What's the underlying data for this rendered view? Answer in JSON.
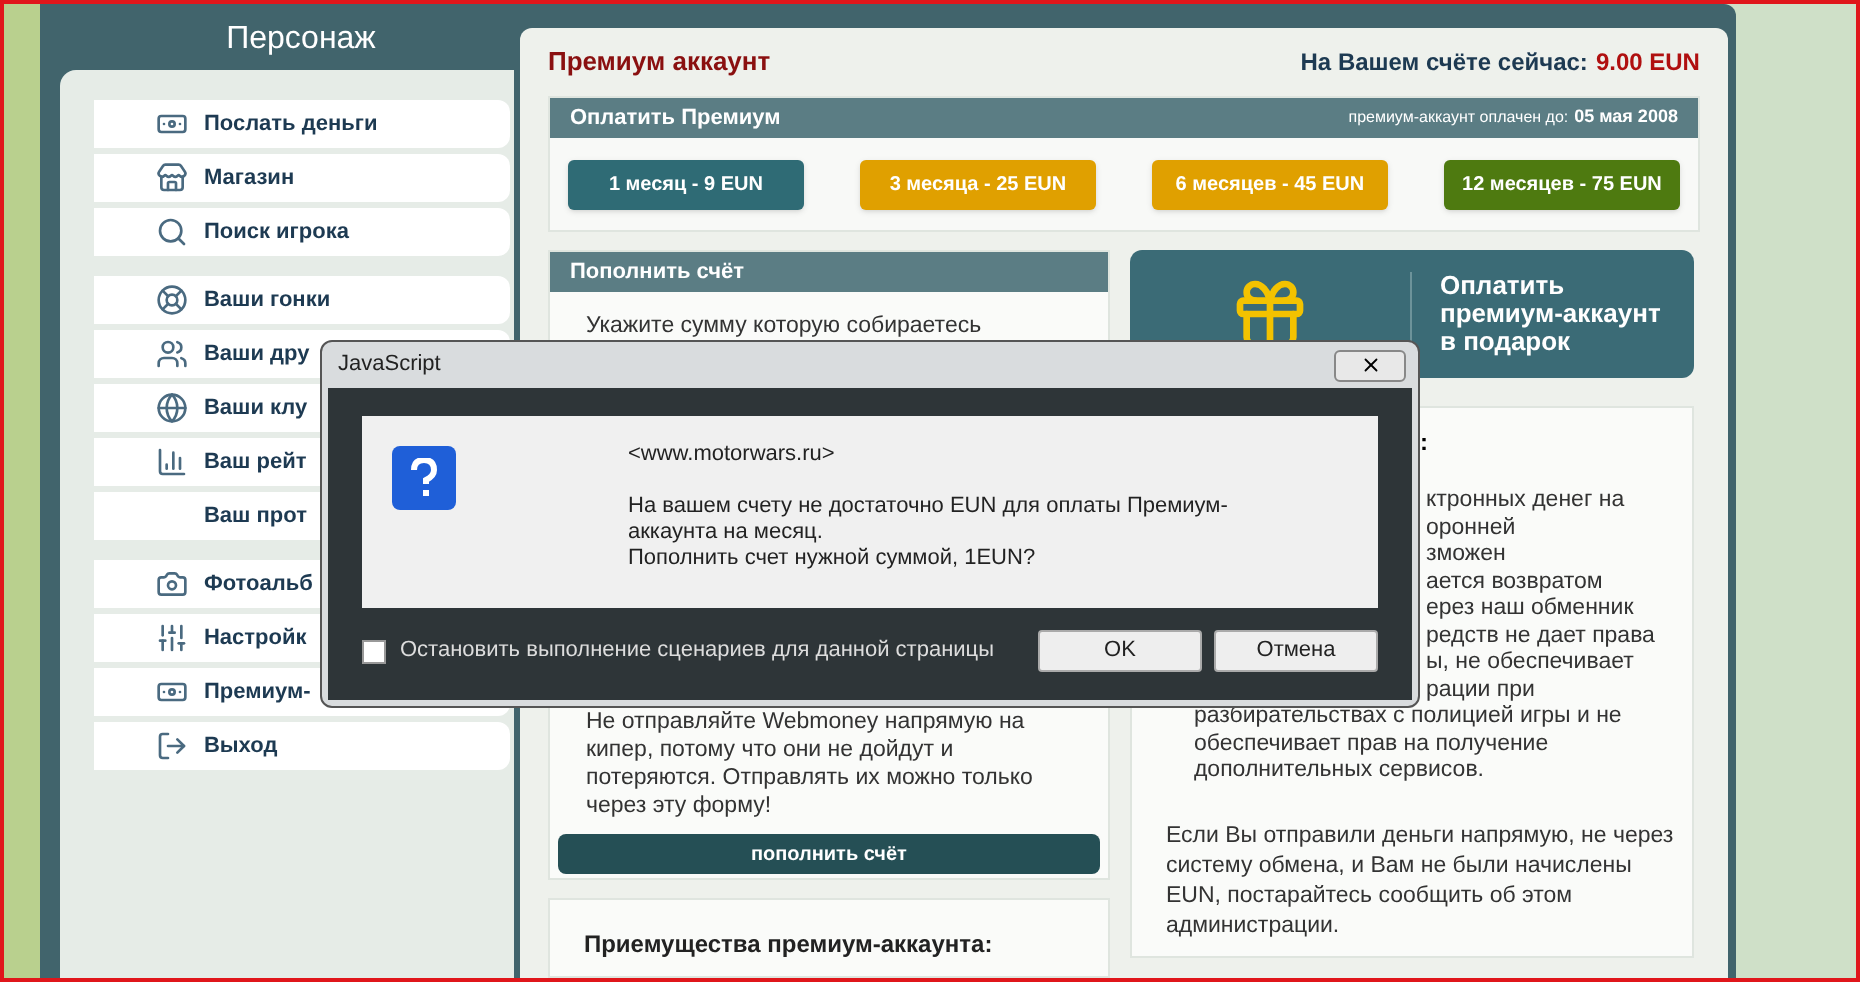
{
  "sidebar": {
    "title": "Персонаж",
    "groups": [
      [
        {
          "label": "Послать деньги"
        },
        {
          "label": "Магазин"
        },
        {
          "label": "Поиск игрока"
        }
      ],
      [
        {
          "label": "Ваши гонки"
        },
        {
          "label": "Ваши дру"
        },
        {
          "label": "Ваши клу"
        },
        {
          "label": "Ваш рейт"
        },
        {
          "label": "Ваш прот"
        }
      ],
      [
        {
          "label": "Фотоальб"
        },
        {
          "label": "Настройк"
        },
        {
          "label": "Премиум-"
        },
        {
          "label": "Выход"
        }
      ]
    ]
  },
  "page": {
    "title": "Премиум аккаунт",
    "balance_label": "На Вашем счёте сейчас:",
    "balance_value": "9.00 EUN"
  },
  "premium": {
    "title": "Оплатить Премиум",
    "paid_until_label": "премиум-аккаунт оплачен до:",
    "paid_until_date": "05 мая 2008",
    "options": [
      {
        "label": "1 месяц - 9 EUN",
        "color": "#2f6b75"
      },
      {
        "label": "3 месяца - 25 EUN",
        "color": "#e0a000"
      },
      {
        "label": "6 месяцев - 45 EUN",
        "color": "#e0a000"
      },
      {
        "label": "12 месяцев - 75 EUN",
        "color": "#4e7a10"
      }
    ]
  },
  "top_up": {
    "title": "Пополнить счёт",
    "intro": "Укажите сумму которую собираетесь",
    "warning_lines": [
      "Не отправляйте Webmoney напрямую на",
      "кипер, потому что они не дойдут и",
      "потеряются. Отправлять их можно только",
      "через эту форму!"
    ],
    "button": "пополнить счёт"
  },
  "advantages": {
    "title": "Приемущества премиум-аккаунта:"
  },
  "gift_banner": {
    "lines": [
      "Оплатить",
      "премиум-аккаунт",
      "в подарок"
    ]
  },
  "info": {
    "heading": ":",
    "lines": [
      {
        "kind": "cut",
        "text": "ктронных денег на"
      },
      {
        "kind": "cut",
        "text": "оронней"
      },
      {
        "kind": "cut",
        "text": "зможен"
      },
      {
        "kind": "cut",
        "text": "ается возвратом"
      },
      {
        "kind": "cut",
        "text": "ерез наш обменник"
      },
      {
        "kind": "cut",
        "text": "редств не дает права"
      },
      {
        "kind": "cut",
        "text": "ы, не обеспечивает"
      },
      {
        "kind": "cut",
        "text": "рации при"
      },
      {
        "kind": "line",
        "text": "разбирательствах с полицией игры и не"
      },
      {
        "kind": "line",
        "text": "обеспечивает прав на получение"
      },
      {
        "kind": "line",
        "text": "дополнительных сервисов."
      }
    ],
    "note": "Если Вы отправили деньги напрямую, не через систему обмена, и Вам не были начислены EUN, постарайтесь сообщить об этом администрации."
  },
  "dialog": {
    "title": "JavaScript",
    "origin": "<www.motorwars.ru>",
    "message_lines": [
      "На вашем счету не достаточно EUN для оплаты Премиум-",
      "аккаунта на месяц.",
      "Пополнить счет нужной суммой, 1EUN?"
    ],
    "checkbox": {
      "label": "Остановить выполнение сценариев для данной страницы",
      "checked": false
    },
    "buttons": [
      "OK",
      "Отмена"
    ]
  }
}
